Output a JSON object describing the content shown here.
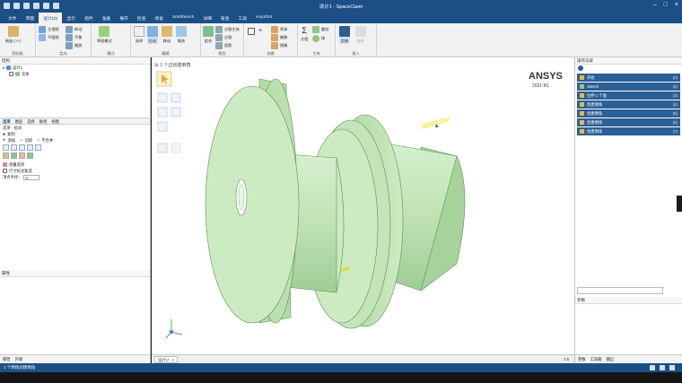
{
  "window": {
    "title": "设计1 - SpaceClaim"
  },
  "ribbon_tabs": [
    "文件",
    "草图",
    "设计(D)",
    "显示",
    "组件",
    "准备",
    "展开",
    "检查",
    "修复",
    "Workbench",
    "详细",
    "钣金",
    "工具",
    "KeyShot"
  ],
  "ribbon": {
    "groups": {
      "clipboard": "剪贴板",
      "orient": "定向",
      "mode": "模式",
      "edit": "编辑",
      "intersect": "相交",
      "create": "创建",
      "body": "主体",
      "insert": "插入"
    },
    "buttons": {
      "paste": "粘贴 ( A )",
      "home": "主视图",
      "plan": "平面图",
      "rotate": "转动",
      "pan": "平移",
      "zoom": "缩放",
      "sketch_mode": "草图模式",
      "select": "选择",
      "pull": "拉动",
      "move": "移动",
      "fill": "填充",
      "combine": "组合",
      "split_body": "分割主体",
      "split": "分割",
      "project": "投影",
      "shell": "壳体",
      "offset": "偏移",
      "equation": "方程",
      "mirror": "镜像",
      "cylinder": "圆柱",
      "sphere": "球",
      "hole": "孔",
      "fix": "修复",
      "repair": "修补",
      "solid": "实体"
    }
  },
  "structure_panel": {
    "title": "结构",
    "tree": [
      "设计1",
      "实体"
    ]
  },
  "options_panel": {
    "tabs": [
      "选项",
      "图层",
      "选择",
      "群组",
      "视图"
    ],
    "header": "选项 - 拉动",
    "option1": "复制",
    "line_add": "添加",
    "line_cut": "切除",
    "line_nomerge": "不合并",
    "measure": "测量选项",
    "checkbox_label": "尺寸标注复选",
    "width_label": "顶点半径：",
    "width_value": "0"
  },
  "properties_panel": {
    "title": "属性",
    "bottom_tabs": [
      "属性",
      "外观"
    ]
  },
  "viewport": {
    "hint": "从 1 个边创建倒角",
    "brand": "ANSYS",
    "version": "2021 R1"
  },
  "viewbar": {
    "tab_label": "设计1*",
    "zoom": "1:5"
  },
  "history_panel": {
    "title": "操作记录",
    "items": [
      {
        "label": "开始",
        "num": "(0)"
      },
      {
        "label": "Sketch",
        "num": "(2)"
      },
      {
        "label": "拉伸 1 个面",
        "num": "(3)"
      },
      {
        "label": "创建倒角",
        "num": "(4)"
      },
      {
        "label": "创建倒角",
        "num": "(5)"
      },
      {
        "label": "创建倒角",
        "num": "(6)"
      },
      {
        "label": "创建倒角",
        "num": "(7)"
      }
    ],
    "params_title": "参数",
    "bottom_tabs": [
      "参数",
      "工具箱",
      "输出"
    ]
  },
  "status": {
    "text": "1 个倒角创建倒角"
  },
  "colors": {
    "title_bar": "#1b4f86",
    "part_green": "#bfe3b5",
    "history_item": "#2b5f95"
  }
}
